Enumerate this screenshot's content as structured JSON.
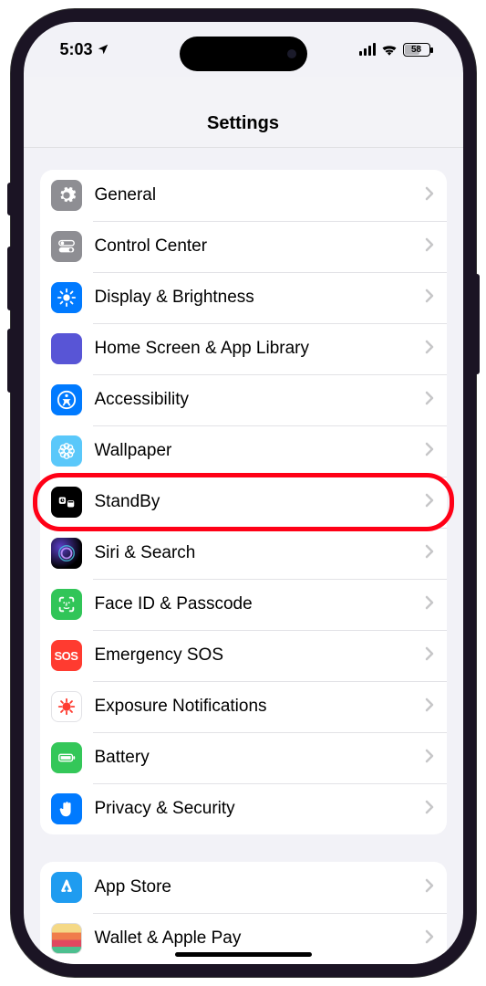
{
  "status": {
    "time": "5:03",
    "battery": "58"
  },
  "header": {
    "title": "Settings"
  },
  "groups": [
    {
      "items": [
        {
          "id": "general",
          "label": "General",
          "icon": "gear",
          "bg": "bg-gray"
        },
        {
          "id": "control-center",
          "label": "Control Center",
          "icon": "switches",
          "bg": "bg-gray"
        },
        {
          "id": "display",
          "label": "Display & Brightness",
          "icon": "sun",
          "bg": "bg-blue"
        },
        {
          "id": "home-screen",
          "label": "Home Screen & App Library",
          "icon": "apps",
          "bg": "home-apps"
        },
        {
          "id": "accessibility",
          "label": "Accessibility",
          "icon": "figure",
          "bg": "bg-blue"
        },
        {
          "id": "wallpaper",
          "label": "Wallpaper",
          "icon": "flower",
          "bg": "bg-cyan"
        },
        {
          "id": "standby",
          "label": "StandBy",
          "icon": "standby",
          "bg": "bg-black",
          "highlight": true
        },
        {
          "id": "siri",
          "label": "Siri & Search",
          "icon": "siri",
          "bg": "bg-siri"
        },
        {
          "id": "faceid",
          "label": "Face ID & Passcode",
          "icon": "face",
          "bg": "bg-green"
        },
        {
          "id": "sos",
          "label": "Emergency SOS",
          "icon": "sos",
          "bg": "bg-red"
        },
        {
          "id": "exposure",
          "label": "Exposure Notifications",
          "icon": "virus",
          "bg": "bg-white"
        },
        {
          "id": "battery",
          "label": "Battery",
          "icon": "battery",
          "bg": "bg-green2"
        },
        {
          "id": "privacy",
          "label": "Privacy & Security",
          "icon": "hand",
          "bg": "bg-blue"
        }
      ]
    },
    {
      "items": [
        {
          "id": "appstore",
          "label": "App Store",
          "icon": "appstore",
          "bg": "bg-appstore"
        },
        {
          "id": "wallet",
          "label": "Wallet & Apple Pay",
          "icon": "wallet",
          "bg": "bg-wallet"
        }
      ]
    }
  ]
}
